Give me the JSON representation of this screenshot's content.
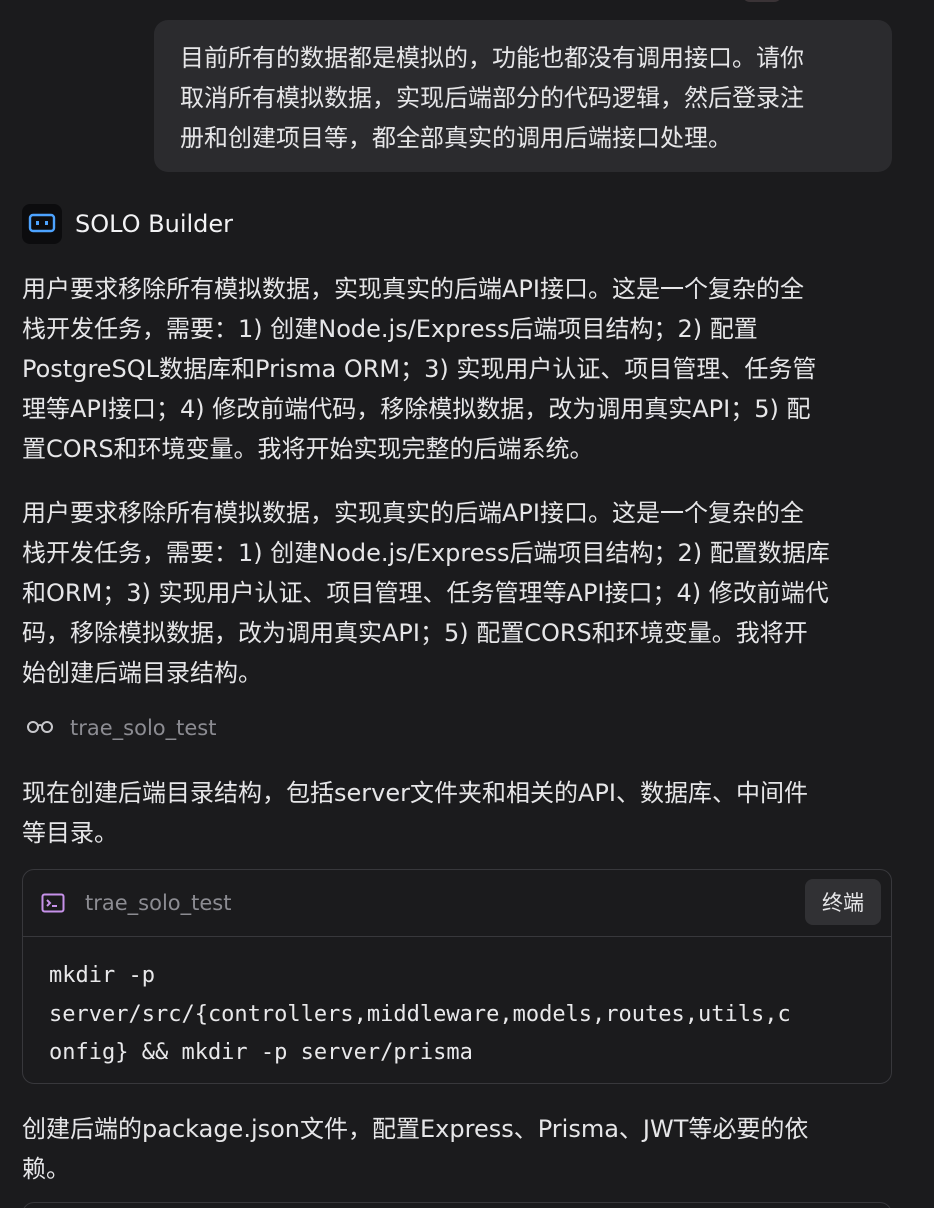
{
  "user_message": {
    "lines": [
      "目前所有的数据都是模拟的，功能也都没有调用接口。请你",
      "取消所有模拟数据，实现后端部分的代码逻辑，然后登录注",
      "册和创建项目等，都全部真实的调用后端接口处理。"
    ]
  },
  "agent": {
    "name": "SOLO Builder",
    "logo_icon": "robot-face-icon"
  },
  "messages": {
    "p1": {
      "lines": [
        "用户要求移除所有模拟数据，实现真实的后端API接口。这是一个复杂的全",
        "栈开发任务，需要：1) 创建Node.js/Express后端项目结构；2) 配置",
        "PostgreSQL数据库和Prisma ORM；3) 实现用户认证、项目管理、任务管",
        "理等API接口；4) 修改前端代码，移除模拟数据，改为调用真实API；5) 配",
        "置CORS和环境变量。我将开始实现完整的后端系统。"
      ]
    },
    "p2": {
      "lines": [
        "用户要求移除所有模拟数据，实现真实的后端API接口。这是一个复杂的全",
        "栈开发任务，需要：1) 创建Node.js/Express后端项目结构；2) 配置数据库",
        "和ORM；3) 实现用户认证、项目管理、任务管理等API接口；4) 修改前端代",
        "码，移除模拟数据，改为调用真实API；5) 配置CORS和环境变量。我将开",
        "始创建后端目录结构。"
      ]
    },
    "p3": {
      "lines": [
        "现在创建后端目录结构，包括server文件夹和相关的API、数据库、中间件",
        "等目录。"
      ]
    },
    "p4": {
      "lines": [
        "创建后端的package.json文件，配置Express、Prisma、JWT等必要的依",
        "赖。"
      ]
    }
  },
  "tool_call": {
    "icon": "glasses-icon",
    "label": "trae_solo_test"
  },
  "terminal": {
    "icon": "terminal-icon",
    "title": "trae_solo_test",
    "button_label": "终端",
    "code_lines": [
      "mkdir -p",
      "server/src/{controllers,middleware,models,routes,utils,c",
      "onfig} && mkdir -p server/prisma"
    ]
  },
  "colors": {
    "background": "#1b1b1d",
    "bubble": "#2b2b2e",
    "border": "#38383c",
    "muted_text": "#8c8c92",
    "logo_accent": "#4da3ff",
    "terminal_icon": "#c792ea"
  }
}
